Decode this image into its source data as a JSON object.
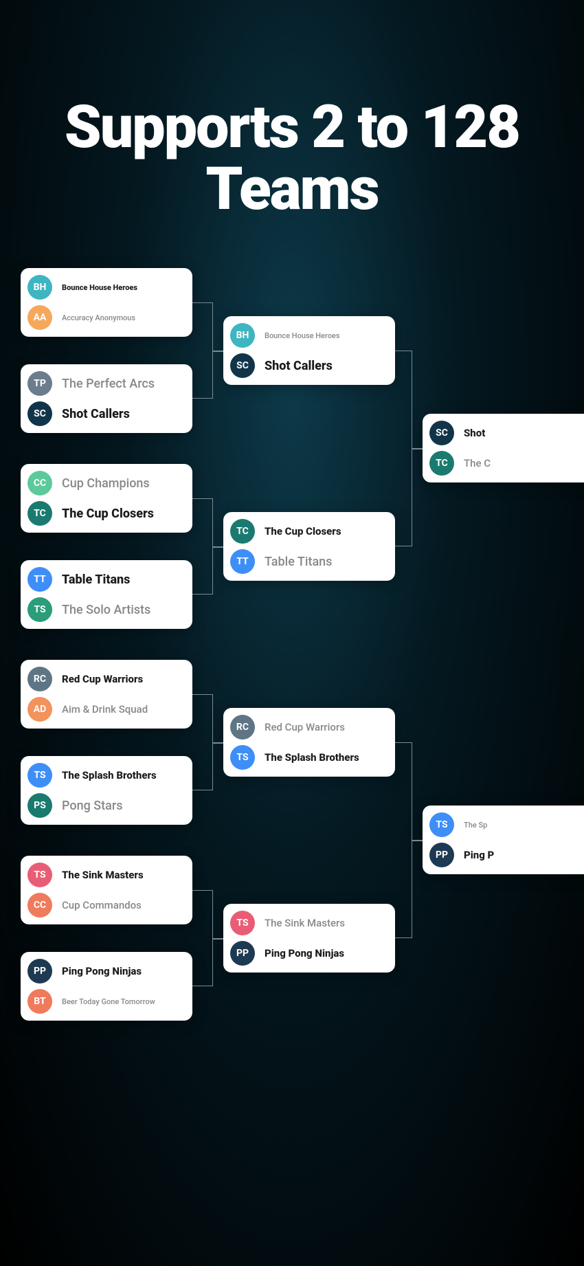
{
  "headline": "Supports 2 to 128 Teams",
  "colors": {
    "teal": "#3eb5c1",
    "orange": "#f5a85c",
    "slate": "#6b7d8c",
    "navy": "#12344a",
    "mint": "#5cc99a",
    "tealDark": "#1a7a70",
    "blue": "#3e8ef7",
    "green": "#2a9d7a",
    "grayBlue": "#5e7585",
    "orangeRed": "#f2935c",
    "pink": "#e85d75",
    "coral": "#f07a5c",
    "darkNavy": "#1e3a52"
  },
  "r1": [
    {
      "t1": {
        "abbr": "BH",
        "name": "Bounce House Heroes",
        "color": "teal",
        "win": true,
        "size": "small"
      },
      "t2": {
        "abbr": "AA",
        "name": "Accuracy Anonymous",
        "color": "orange",
        "win": false,
        "size": "small"
      }
    },
    {
      "t1": {
        "abbr": "TP",
        "name": "The Perfect Arcs",
        "color": "slate",
        "win": false,
        "size": "big"
      },
      "t2": {
        "abbr": "SC",
        "name": "Shot Callers",
        "color": "navy",
        "win": true,
        "size": "big"
      }
    },
    {
      "t1": {
        "abbr": "CC",
        "name": "Cup Champions",
        "color": "mint",
        "win": false,
        "size": "big"
      },
      "t2": {
        "abbr": "TC",
        "name": "The Cup Closers",
        "color": "tealDark",
        "win": true,
        "size": "big"
      }
    },
    {
      "t1": {
        "abbr": "TT",
        "name": "Table Titans",
        "color": "blue",
        "win": true,
        "size": "big"
      },
      "t2": {
        "abbr": "TS",
        "name": "The Solo Artists",
        "color": "green",
        "win": false,
        "size": "big"
      }
    },
    {
      "t1": {
        "abbr": "RC",
        "name": "Red Cup Warriors",
        "color": "grayBlue",
        "win": true
      },
      "t2": {
        "abbr": "AD",
        "name": "Aim & Drink Squad",
        "color": "orangeRed",
        "win": false
      }
    },
    {
      "t1": {
        "abbr": "TS",
        "name": "The Splash Brothers",
        "color": "blue",
        "win": true
      },
      "t2": {
        "abbr": "PS",
        "name": "Pong Stars",
        "color": "tealDark",
        "win": false,
        "size": "big"
      }
    },
    {
      "t1": {
        "abbr": "TS",
        "name": "The Sink Masters",
        "color": "pink",
        "win": true
      },
      "t2": {
        "abbr": "CC",
        "name": "Cup Commandos",
        "color": "coral",
        "win": false
      }
    },
    {
      "t1": {
        "abbr": "PP",
        "name": "Ping Pong Ninjas",
        "color": "darkNavy",
        "win": true
      },
      "t2": {
        "abbr": "BT",
        "name": "Beer Today Gone Tomorrow",
        "color": "coral",
        "win": false,
        "size": "small"
      }
    }
  ],
  "r2": [
    {
      "t1": {
        "abbr": "BH",
        "name": "Bounce House Heroes",
        "color": "teal",
        "win": false,
        "size": "small"
      },
      "t2": {
        "abbr": "SC",
        "name": "Shot Callers",
        "color": "navy",
        "win": true,
        "size": "big"
      }
    },
    {
      "t1": {
        "abbr": "TC",
        "name": "The Cup Closers",
        "color": "tealDark",
        "win": true
      },
      "t2": {
        "abbr": "TT",
        "name": "Table Titans",
        "color": "blue",
        "win": false,
        "size": "big"
      }
    },
    {
      "t1": {
        "abbr": "RC",
        "name": "Red Cup Warriors",
        "color": "grayBlue",
        "win": false
      },
      "t2": {
        "abbr": "TS",
        "name": "The Splash Brothers",
        "color": "blue",
        "win": true
      }
    },
    {
      "t1": {
        "abbr": "TS",
        "name": "The Sink Masters",
        "color": "pink",
        "win": false
      },
      "t2": {
        "abbr": "PP",
        "name": "Ping Pong Ninjas",
        "color": "darkNavy",
        "win": true
      }
    }
  ],
  "r3": [
    {
      "t1": {
        "abbr": "SC",
        "name": "Shot",
        "color": "navy",
        "win": true
      },
      "t2": {
        "abbr": "TC",
        "name": "The C",
        "color": "tealDark",
        "win": false
      }
    },
    {
      "t1": {
        "abbr": "TS",
        "name": "The Sp",
        "color": "blue",
        "win": false,
        "size": "small"
      },
      "t2": {
        "abbr": "PP",
        "name": "Ping P",
        "color": "darkNavy",
        "win": true
      }
    }
  ]
}
